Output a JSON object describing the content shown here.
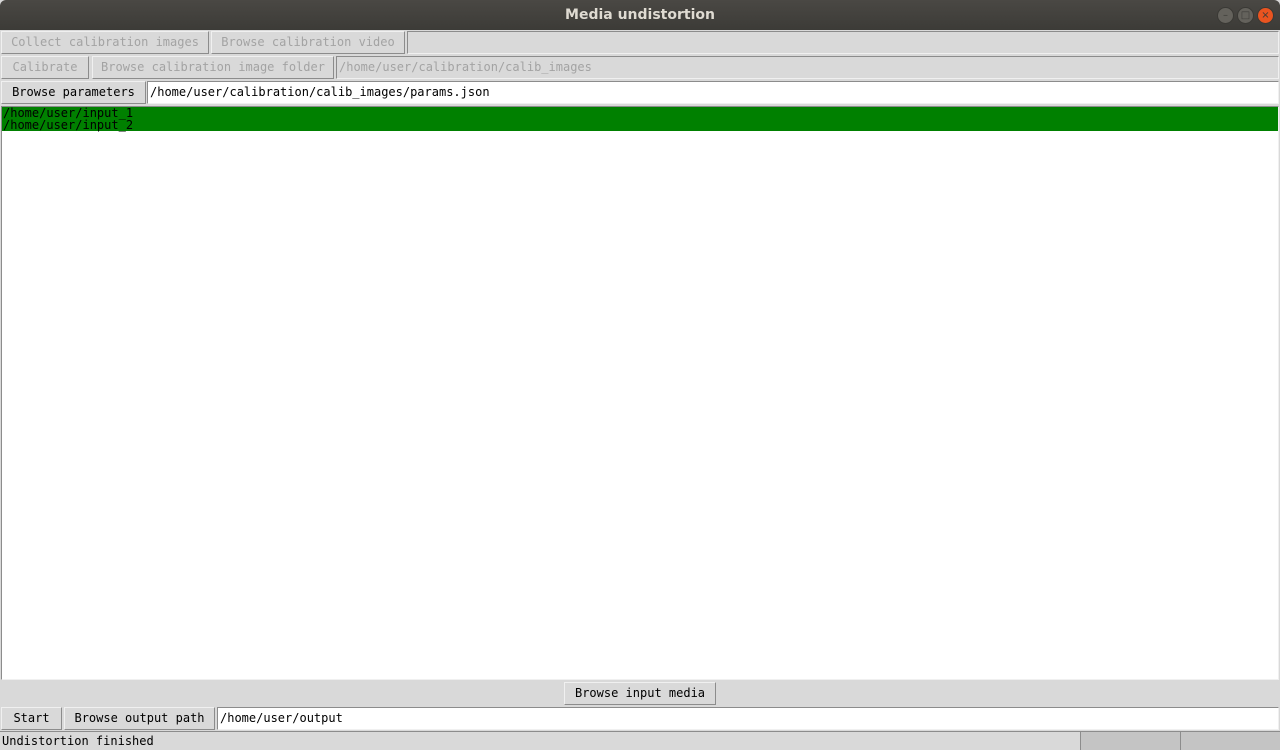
{
  "window": {
    "title": "Media undistortion",
    "controls": {
      "minimize": "minimize-icon",
      "maximize": "maximize-icon",
      "close": "close-icon"
    }
  },
  "calibration": {
    "collect_images_label": "Collect calibration images",
    "browse_video_label": "Browse calibration video",
    "video_path": "",
    "calibrate_label": "Calibrate",
    "browse_folder_label": "Browse calibration image folder",
    "folder_path": "/home/user/calibration/calib_images",
    "browse_params_label": "Browse parameters",
    "params_path": "/home/user/calibration/calib_images/params.json"
  },
  "input_media": {
    "items": [
      "/home/user/input_1",
      "/home/user/input_2"
    ],
    "browse_label": "Browse input media",
    "selected_color": "#008000"
  },
  "output": {
    "start_label": "Start",
    "browse_output_label": "Browse output path",
    "output_path": "/home/user/output"
  },
  "status": {
    "message": "Undistortion finished"
  }
}
